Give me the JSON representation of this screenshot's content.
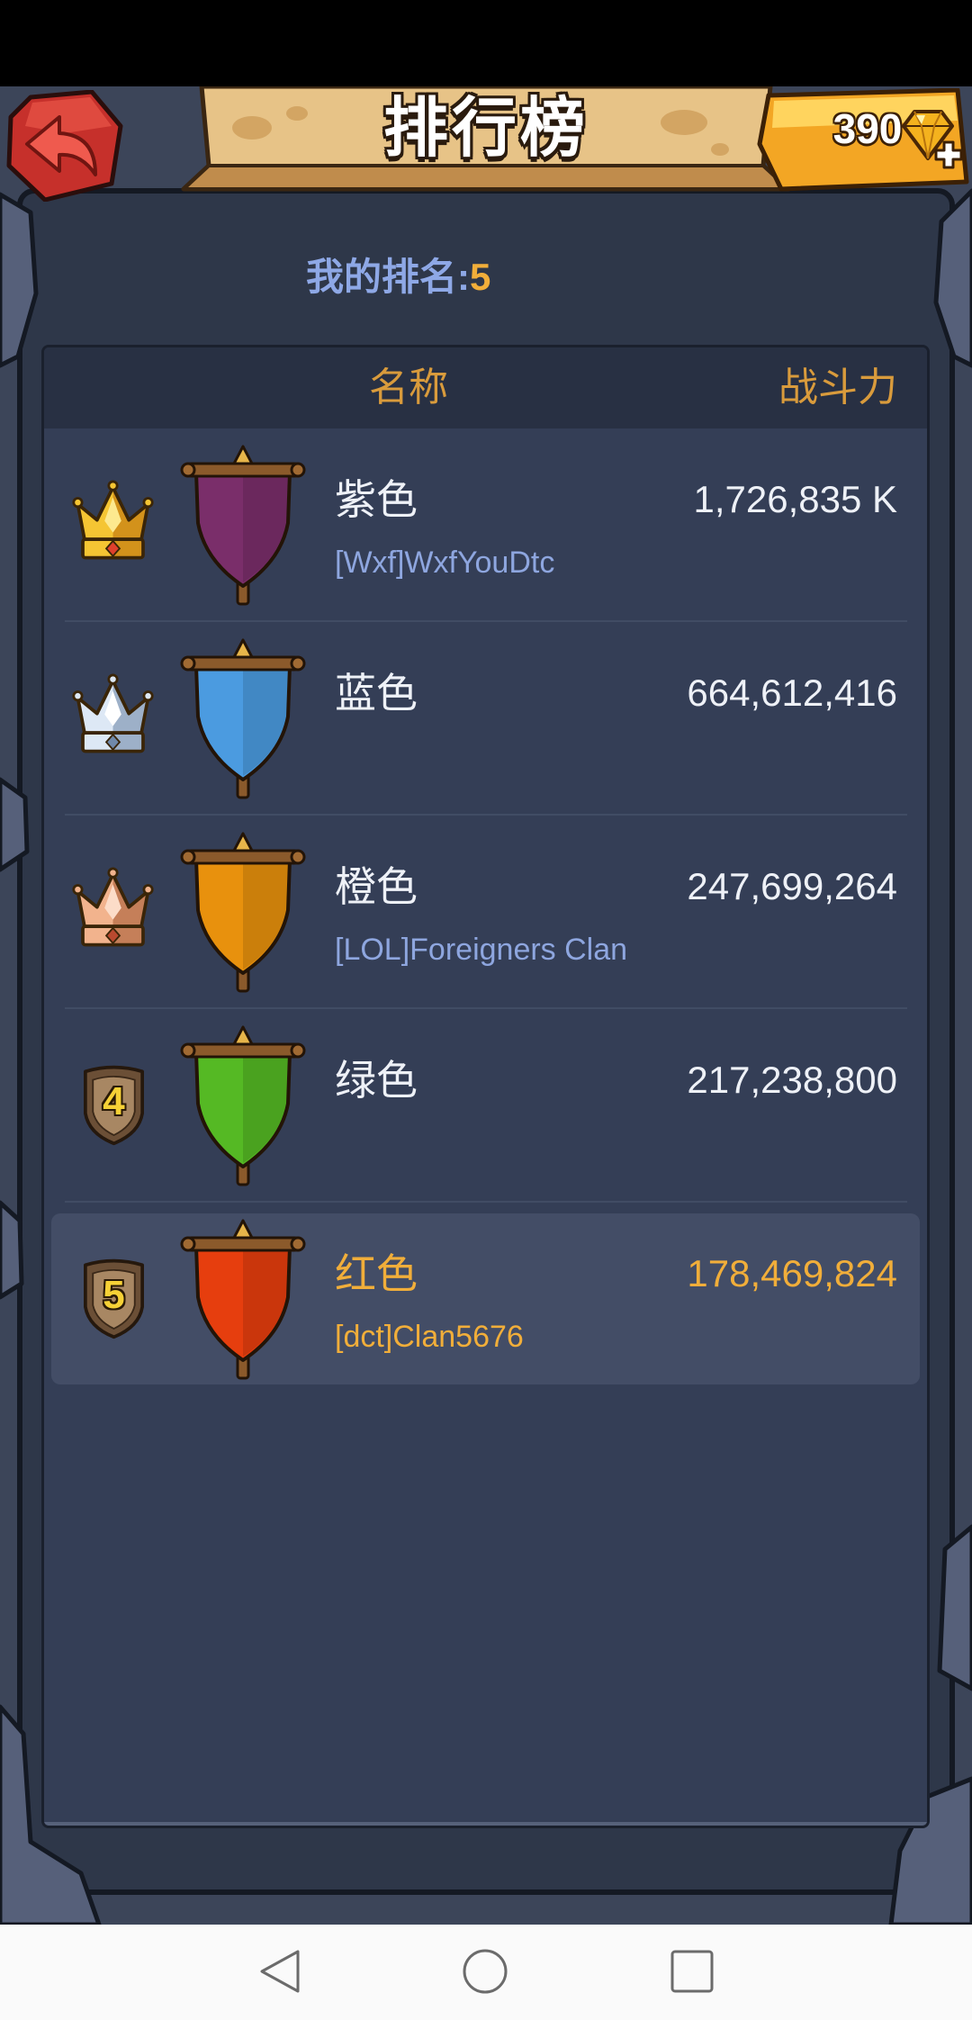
{
  "header": {
    "title": "排行榜",
    "back_icon": "back-arrow-icon",
    "gems": "390",
    "gem_icon": "diamond-icon",
    "add_gems_icon": "plus-icon"
  },
  "my_rank": {
    "label": "我的排名:",
    "value": "5"
  },
  "columns": {
    "name": "名称",
    "power": "战斗力"
  },
  "rows": [
    {
      "rank_icon": "gold-crown-icon",
      "flag_color": "#7a2e6a",
      "name": "紫色",
      "clan": "[Wxf]WxfYouDtc",
      "power": "1,726,835 K"
    },
    {
      "rank_icon": "silver-crown-icon",
      "flag_color": "#4b9be0",
      "name": "蓝色",
      "power": "664,612,416"
    },
    {
      "rank_icon": "bronze-crown-icon",
      "flag_color": "#e8910d",
      "name": "橙色",
      "clan": "[LOL]Foreigners Clan",
      "power": "247,699,264"
    },
    {
      "rank_icon": "rank-shield-icon",
      "rank": "4",
      "flag_color": "#55b924",
      "name": "绿色",
      "power": "217,238,800"
    },
    {
      "rank_icon": "rank-shield-icon",
      "rank": "5",
      "flag_color": "#e63e0e",
      "name": "红色",
      "clan": "[dct]Clan5676",
      "power": "178,469,824",
      "highlighted": true
    }
  ],
  "colors": {
    "background": "#2e3749",
    "panel": "#343e56",
    "header_text": "#d99b3c",
    "gold_text": "#f1ae3a",
    "clan_text": "#8ea6df",
    "row_text": "#eef1f7",
    "highlight_row": "#434d66"
  },
  "nav": {
    "back_icon": "nav-back-icon",
    "home_icon": "nav-home-icon",
    "recents_icon": "nav-recents-icon"
  }
}
